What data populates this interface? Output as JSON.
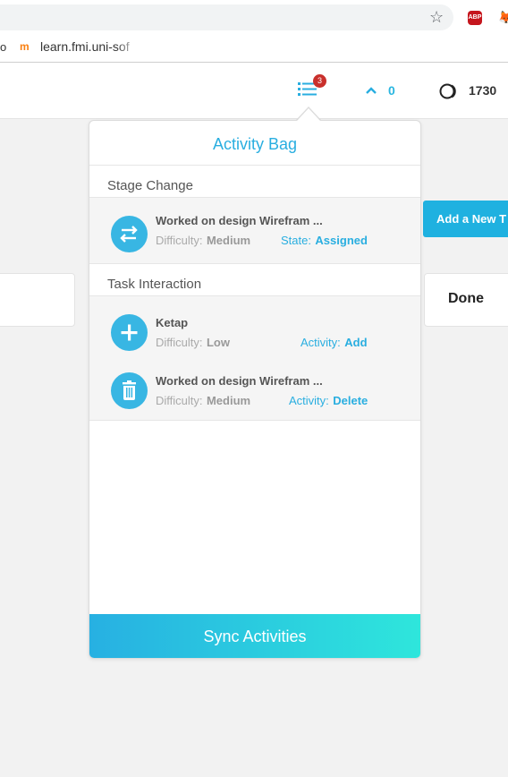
{
  "browser": {
    "omnibox_text": "",
    "bookmark_prev": "o",
    "bookmark_label": "learn.fmi.uni-sof",
    "abp_label": "ABP"
  },
  "header": {
    "activity_badge_count": "3",
    "upvotes": "0",
    "points": "1730"
  },
  "board": {
    "add_task_label": "Add a New T",
    "done_column_label": "Done"
  },
  "activity_bag": {
    "title": "Activity Bag",
    "sections": [
      {
        "title": "Stage Change",
        "items": [
          {
            "icon": "swap-arrows-icon",
            "title": "Worked on design Wirefram ...",
            "difficulty_key": "Difficulty:",
            "difficulty": "Medium",
            "status_key": "State:",
            "status": "Assigned"
          }
        ]
      },
      {
        "title": "Task Interaction",
        "items": [
          {
            "icon": "plus-icon",
            "title": "Ketap",
            "difficulty_key": "Difficulty:",
            "difficulty": "Low",
            "status_key": "Activity:",
            "status": "Add"
          },
          {
            "icon": "trash-icon",
            "title": "Worked on design Wirefram ...",
            "difficulty_key": "Difficulty:",
            "difficulty": "Medium",
            "status_key": "Activity:",
            "status": "Delete"
          }
        ]
      }
    ],
    "sync_label": "Sync Activities"
  },
  "colors": {
    "accent": "#29aee0",
    "badge": "#c9302c",
    "sync_gradient_start": "#27b0e2",
    "sync_gradient_end": "#2ee6dc"
  }
}
